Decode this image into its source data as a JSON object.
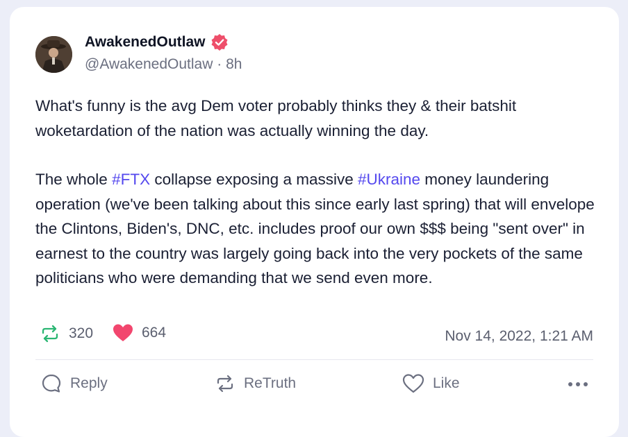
{
  "post": {
    "display_name": "AwakenedOutlaw",
    "handle": "@AwakenedOutlaw",
    "separator": "·",
    "relative_time": "8h",
    "paragraph1": "What's funny is the avg Dem voter probably thinks they & their batshit woketardation of the nation was actually winning the day.",
    "paragraph2": {
      "part1": "The whole ",
      "tag1": "#FTX",
      "part2": " collapse exposing a massive ",
      "tag2": "#Ukraine",
      "part3": " money laundering operation (we've been talking about this since early last spring) that will envelope the Clintons, Biden's, DNC, etc. includes proof our own $$$ being \"sent over\" in earnest to the country was largely going back into the very pockets of the same politicians who were demanding that we send even more."
    },
    "retruth_count": "320",
    "like_count": "664",
    "timestamp": "Nov 14, 2022, 1:21 AM"
  },
  "actions": {
    "reply": "Reply",
    "retruth": "ReTruth",
    "like": "Like"
  },
  "icons": {
    "verified": "verified-badge-icon",
    "retruth": "retruth-icon",
    "heart": "heart-icon",
    "reply": "reply-icon",
    "like": "heart-outline-icon",
    "more": "more-horizontal-icon"
  },
  "colors": {
    "accent": "#5448ee",
    "retruth_green": "#2bb673",
    "heart_pink": "#f2466e",
    "verified_pink": "#ee4e6a"
  }
}
